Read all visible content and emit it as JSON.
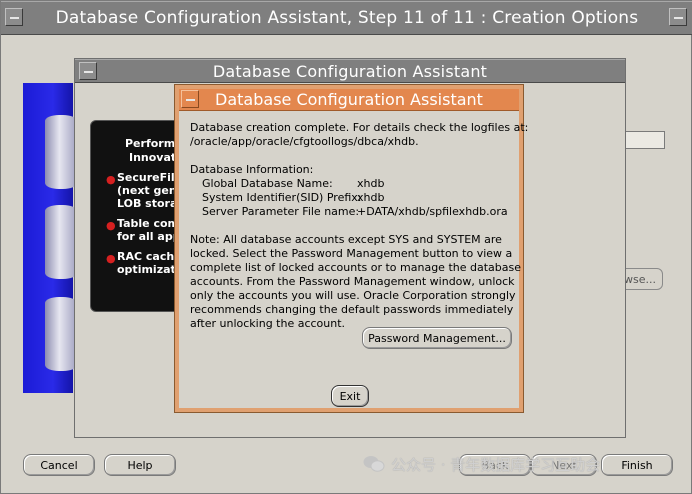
{
  "outer_window": {
    "title": "Database Configuration Assistant, Step 11 of 11 : Creation Options",
    "cancel_label": "Cancel",
    "help_label": "Help",
    "back_label": "Back",
    "next_label": "Next",
    "finish_label": "Finish",
    "browse_label": "wse..."
  },
  "progress": {
    "percent": 100,
    "color": "#0000f0"
  },
  "middle_dialog": {
    "title": "Database Configuration Assistant",
    "promo": {
      "heading_1": "Performan",
      "heading_2": "Innovatio",
      "item_1a": "SecureFiles",
      "item_1b": "(next genera",
      "item_1c": "LOB storage",
      "item_2a": "Table comp",
      "item_2b": "for all appli",
      "item_3a": "RAC cache",
      "item_3b": "optimizatio"
    }
  },
  "front_dialog": {
    "title": "Database Configuration Assistant",
    "intro_line1": "Database creation complete. For details check the logfiles at:",
    "intro_line2": " /oracle/app/oracle/cfgtoollogs/dbca/xhdb.",
    "info_heading": "Database Information:",
    "info": [
      {
        "label": "Global Database Name:",
        "value": "xhdb"
      },
      {
        "label": "System Identifier(SID) Prefix:",
        "value": "xhdb"
      },
      {
        "label": "Server Parameter File name:",
        "value": "+DATA/xhdb/spfilexhdb.ora"
      }
    ],
    "note_lines": [
      "Note: All database accounts except SYS and SYSTEM are",
      "locked. Select the Password Management button to view a",
      "complete list of locked accounts or to manage the database",
      "accounts. From the Password Management window, unlock",
      "only the accounts you will use. Oracle Corporation strongly",
      "recommends changing the default passwords immediately",
      "after unlocking the account."
    ],
    "password_button": "Password Management...",
    "exit_button": "Exit"
  },
  "watermark": {
    "text": "公众号 · 青年数据库学习互助会"
  },
  "colors": {
    "window_bg": "#d6d3cb",
    "titlebar_gray": "#7f7f7f",
    "active_title_orange": "#e3874e",
    "banner_blue": "#2a2ae8"
  }
}
